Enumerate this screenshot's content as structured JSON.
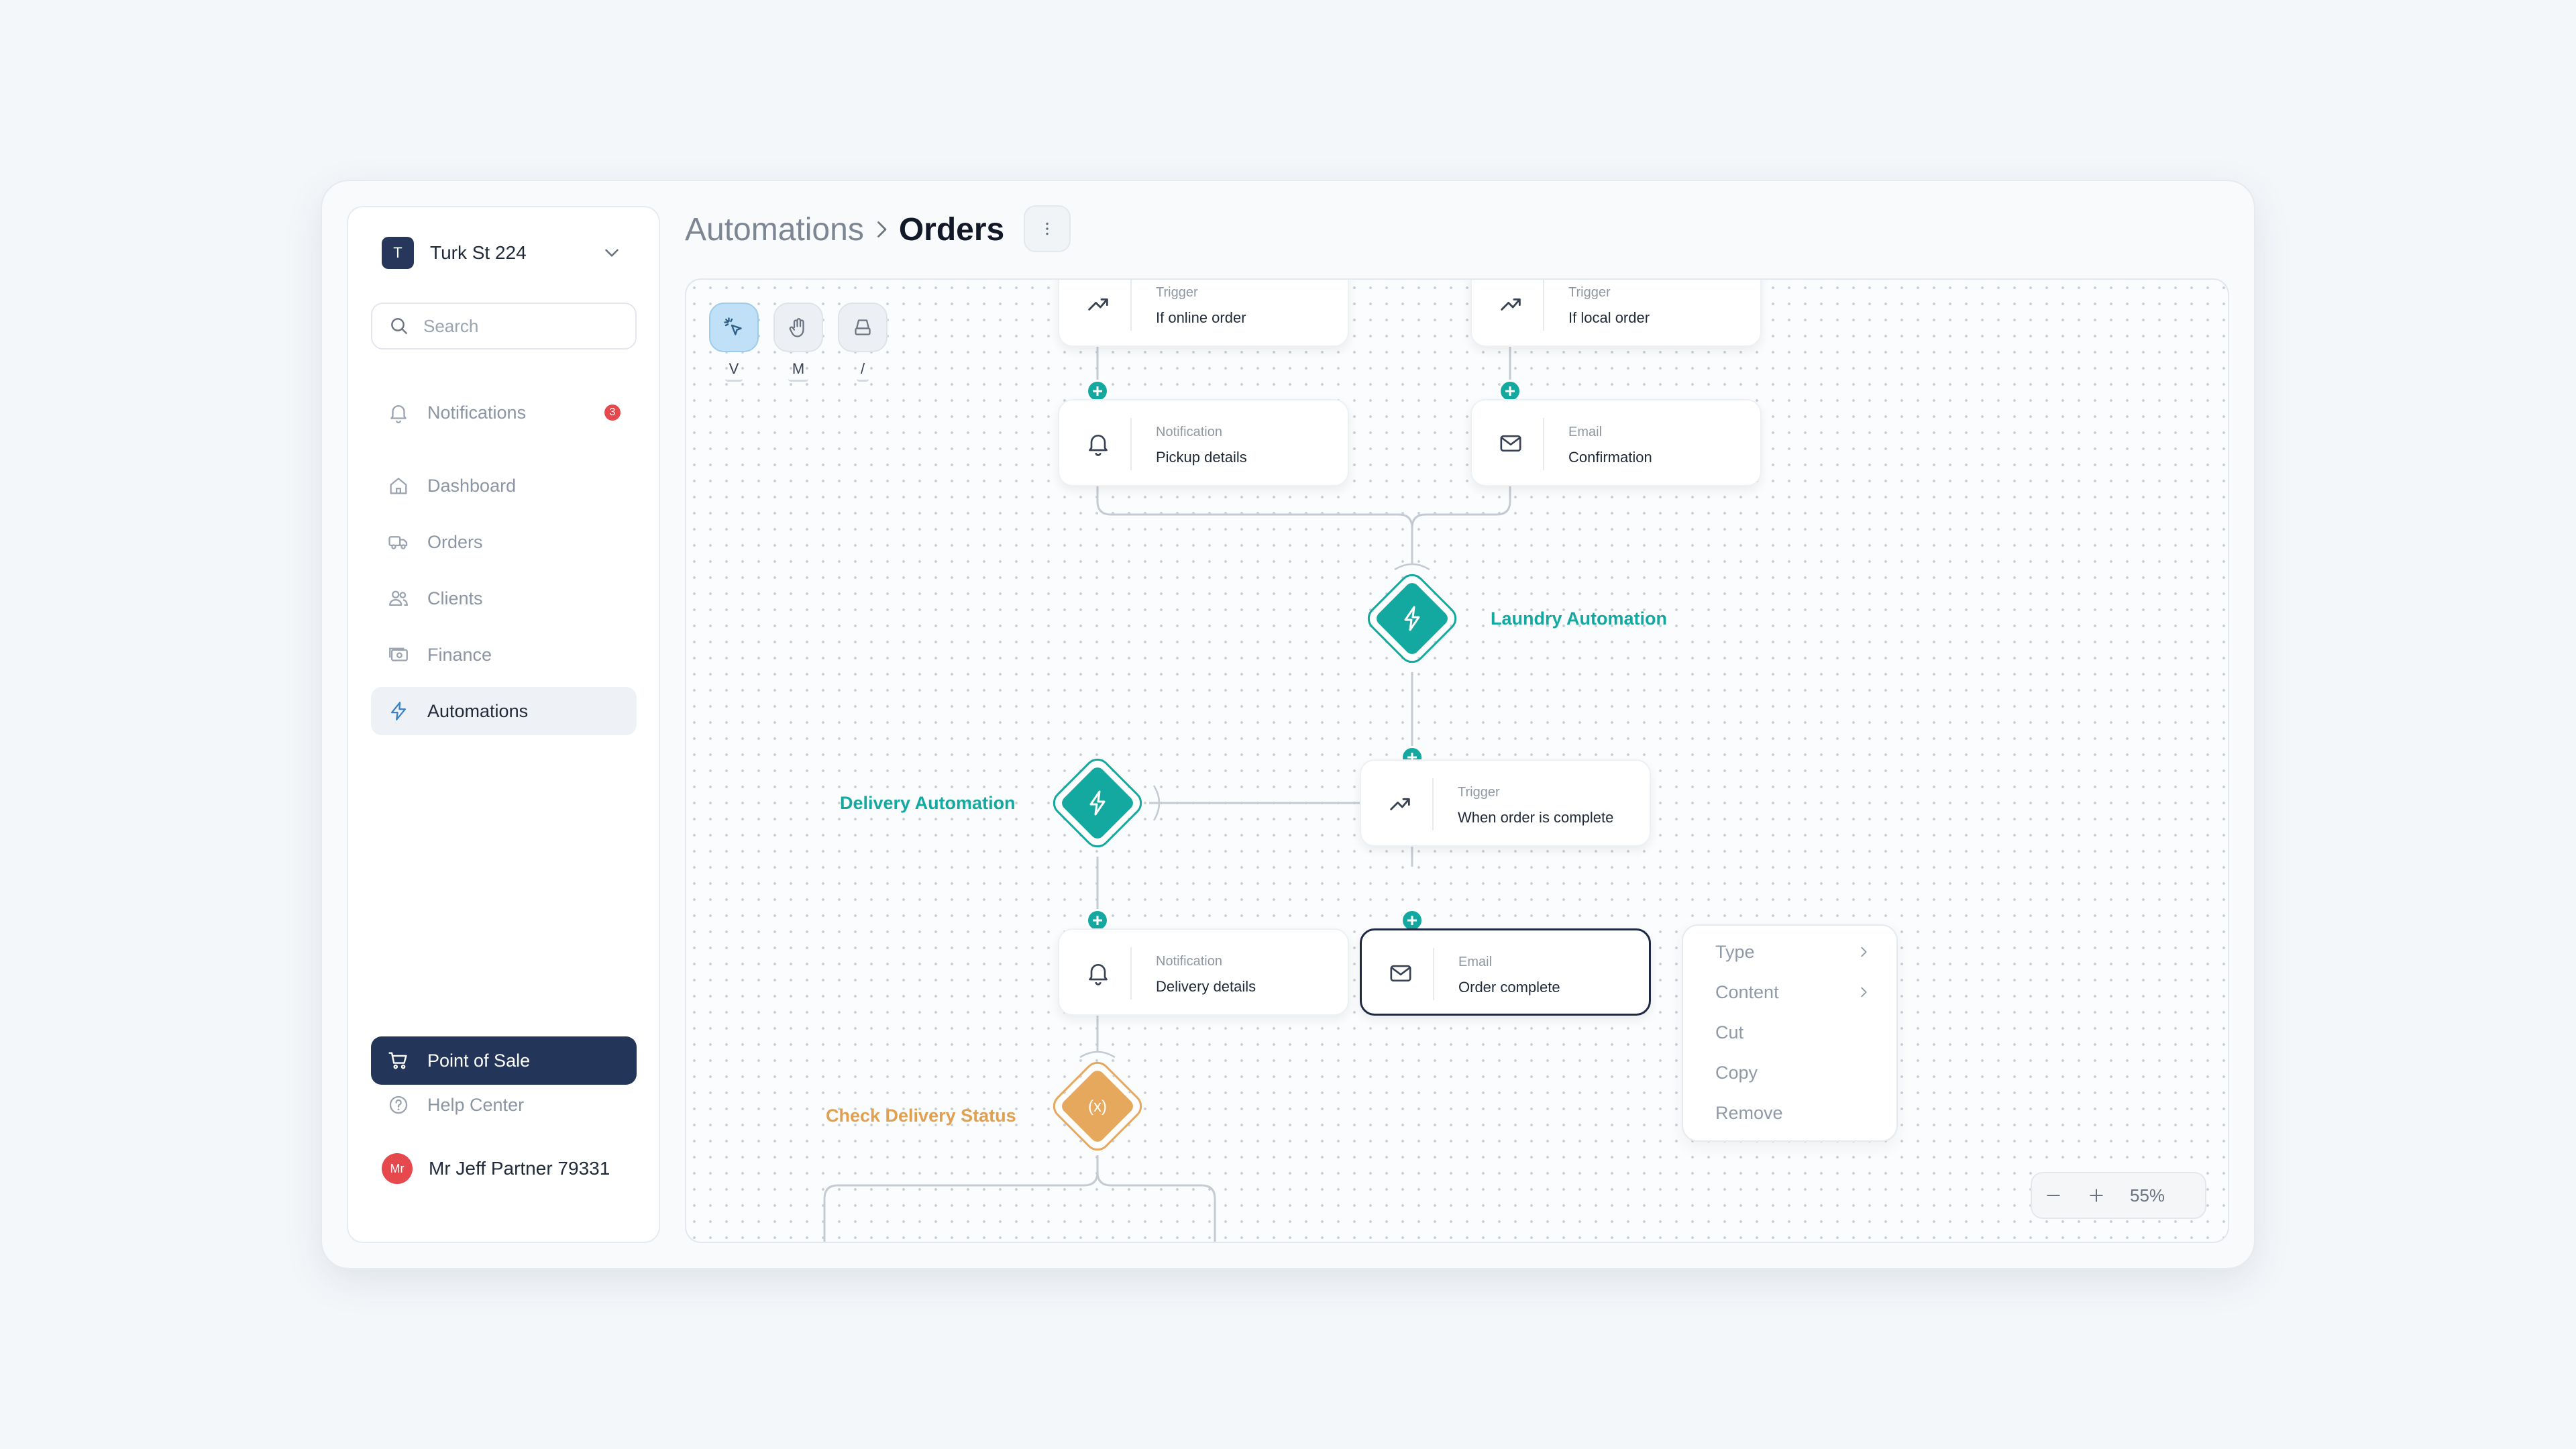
{
  "workspace": {
    "avatar": "T",
    "name": "Turk St 224"
  },
  "search": {
    "placeholder": "Search"
  },
  "sidebar": {
    "notifications": {
      "label": "Notifications",
      "badge": "3"
    },
    "items": [
      {
        "label": "Dashboard",
        "icon": "home-icon"
      },
      {
        "label": "Orders",
        "icon": "truck-icon"
      },
      {
        "label": "Clients",
        "icon": "users-icon"
      },
      {
        "label": "Finance",
        "icon": "cash-icon"
      },
      {
        "label": "Automations",
        "icon": "bolt-icon",
        "active": true
      }
    ],
    "pos_label": "Point of Sale",
    "help_label": "Help Center",
    "user": {
      "initials": "Mr",
      "name": "Mr Jeff Partner 79331"
    }
  },
  "header": {
    "breadcrumb_parent": "Automations",
    "breadcrumb_current": "Orders"
  },
  "tools": [
    {
      "key": "V",
      "icon": "select-cursor-icon",
      "active": true
    },
    {
      "key": "M",
      "icon": "hand-icon",
      "active": false
    },
    {
      "key": "/",
      "icon": "eraser-icon",
      "active": false
    }
  ],
  "flow": {
    "cards": {
      "trigger_online": {
        "type": "Trigger",
        "text": "If online order",
        "icon": "trend-up-icon"
      },
      "trigger_local": {
        "type": "Trigger",
        "text": "If local order",
        "icon": "trend-up-icon"
      },
      "notif_pickup": {
        "type": "Notification",
        "text": "Pickup details",
        "icon": "bell-icon"
      },
      "email_confirm": {
        "type": "Email",
        "text": "Confirmation",
        "icon": "mail-icon"
      },
      "trigger_complete": {
        "type": "Trigger",
        "text": "When order is complete",
        "icon": "trend-up-icon"
      },
      "notif_delivery": {
        "type": "Notification",
        "text": "Delivery details",
        "icon": "bell-icon"
      },
      "email_complete": {
        "type": "Email",
        "text": "Order complete",
        "icon": "mail-icon",
        "selected": true
      }
    },
    "diamonds": {
      "laundry": {
        "label": "Laundry Automation",
        "color": "#14a9a0",
        "icon": "bolt-icon"
      },
      "delivery": {
        "label": "Delivery Automation",
        "color": "#14a9a0",
        "icon": "bolt-icon"
      },
      "check": {
        "label": "Check Delivery Status",
        "color": "#e6a85c",
        "icon": "(x)"
      }
    }
  },
  "context_menu": {
    "items": [
      {
        "label": "Type",
        "submenu": true
      },
      {
        "label": "Content",
        "submenu": true
      },
      {
        "label": "Cut",
        "submenu": false
      },
      {
        "label": "Copy",
        "submenu": false
      },
      {
        "label": "Remove",
        "submenu": false
      }
    ]
  },
  "zoom": {
    "level": "55%"
  },
  "colors": {
    "accent": "#14a9a0",
    "brand": "#24355a",
    "warning": "#e6a85c",
    "danger": "#e5484d"
  }
}
